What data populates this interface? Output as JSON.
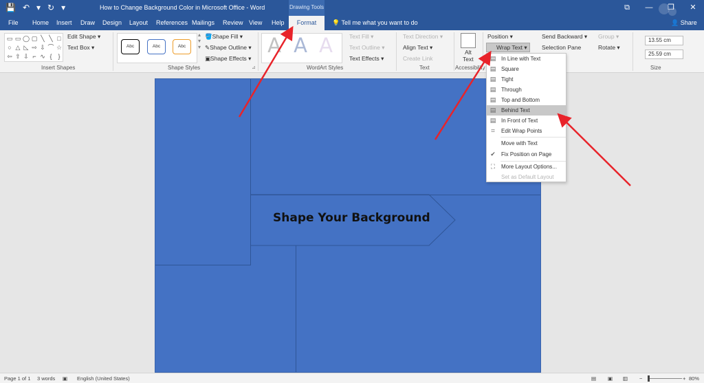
{
  "title_bar": {
    "doc_title": "How to Change Background Color in Microsoft Office - Word",
    "drawing_tools": "Drawing Tools",
    "save_icon": "💾",
    "undo_icon": "↶",
    "redo_icon": "↻",
    "qat_more_icon": "▾",
    "ribbon_display_icon": "⧉",
    "minimize_icon": "—",
    "restore_icon": "❐",
    "close_icon": "✕"
  },
  "tabs": [
    {
      "label": "File"
    },
    {
      "label": "Home"
    },
    {
      "label": "Insert"
    },
    {
      "label": "Draw"
    },
    {
      "label": "Design"
    },
    {
      "label": "Layout"
    },
    {
      "label": "References"
    },
    {
      "label": "Mailings"
    },
    {
      "label": "Review"
    },
    {
      "label": "View"
    },
    {
      "label": "Help"
    },
    {
      "label": "Format"
    }
  ],
  "tell_me": "Tell me what you want to do",
  "share": "Share",
  "ribbon": {
    "insert_shapes": {
      "label": "Insert Shapes",
      "edit_shape": "Edit Shape ▾",
      "text_box": "Text Box ▾"
    },
    "shape_styles": {
      "label": "Shape Styles",
      "swatch_1": "Abc",
      "swatch_2": "Abc",
      "swatch_3": "Abc",
      "shape_fill": "Shape Fill ▾",
      "shape_outline": "Shape Outline ▾",
      "shape_effects": "Shape Effects ▾"
    },
    "wordart_styles": {
      "label": "WordArt Styles",
      "letter_1": "A",
      "letter_2": "A",
      "letter_3": "A",
      "text_fill": "Text Fill ▾",
      "text_outline": "Text Outline ▾",
      "text_effects": "Text Effects ▾"
    },
    "text": {
      "label": "Text",
      "text_direction": "Text Direction ▾",
      "align_text": "Align Text ▾",
      "create_link": "Create Link"
    },
    "accessibility": {
      "label": "Accessibility",
      "alt_text_1": "Alt",
      "alt_text_2": "Text"
    },
    "arrange": {
      "position": "Position ▾",
      "wrap_text": "Wrap Text ▾",
      "send_backward": "Send Backward ▾",
      "selection_pane": "Selection Pane",
      "group": "Group ▾",
      "rotate": "Rotate ▾"
    },
    "size": {
      "label": "Size",
      "height": "13.55 cm",
      "width": "25.59 cm"
    }
  },
  "wrap_menu": {
    "items": [
      {
        "label": "In Line with Text"
      },
      {
        "label": "Square"
      },
      {
        "label": "Tight"
      },
      {
        "label": "Through"
      },
      {
        "label": "Top and Bottom"
      },
      {
        "label": "Behind Text"
      },
      {
        "label": "In Front of Text"
      },
      {
        "label": "Edit Wrap Points"
      },
      {
        "label": "Move with Text"
      },
      {
        "label": "Fix Position on Page"
      },
      {
        "label": "More Layout Options..."
      },
      {
        "label": "Set as Default Layout"
      }
    ]
  },
  "document": {
    "heading": "Shape Your Background",
    "page_color": "#4472c4"
  },
  "status_bar": {
    "page": "Page 1 of 1",
    "words": "3 words",
    "language": "English (United States)",
    "zoom": "80%"
  },
  "colors": {
    "title_bar": "#2b579a",
    "arrow": "#e8232a"
  }
}
